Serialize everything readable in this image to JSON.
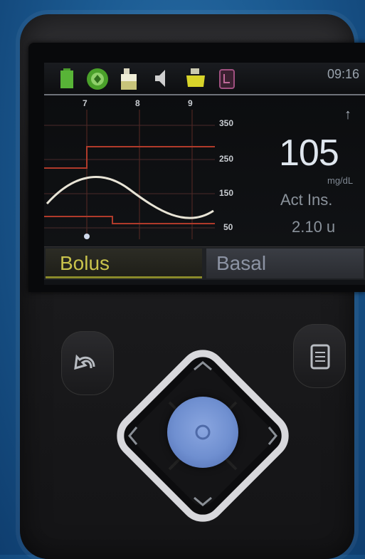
{
  "status": {
    "time": "09:16",
    "icons": [
      "battery-icon",
      "connection-icon",
      "reservoir-icon",
      "sound-icon",
      "sensor-icon",
      "calibration-icon"
    ]
  },
  "chart": {
    "x_ticks": [
      "7",
      "8",
      "9"
    ],
    "y_ticks": [
      "350",
      "250",
      "150",
      "50"
    ]
  },
  "reading": {
    "value": "105",
    "unit": "mg/dL",
    "trend": "↑",
    "active_insulin_label": "Act Ins.",
    "active_insulin_value": "2.10 u"
  },
  "tabs": {
    "bolus": "Bolus",
    "basal": "Basal"
  },
  "colors": {
    "glucose_line": "#e8e4d6",
    "limit_lines": "#b03a2a",
    "bolus_tab": "#c9c34c",
    "basal_tab": "#8c93a3",
    "center_button": "#6f8fd0"
  }
}
